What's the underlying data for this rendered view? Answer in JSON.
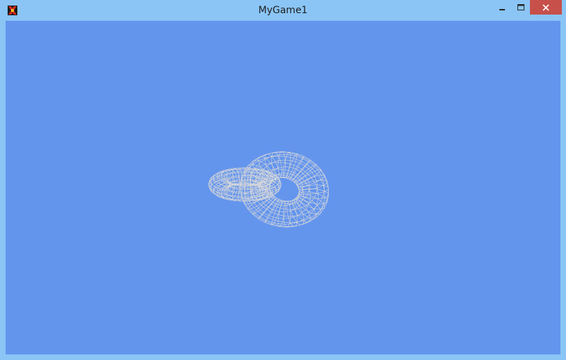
{
  "window": {
    "title": "MyGame1",
    "app_icon": "game-app-icon",
    "controls": {
      "minimize_icon": "minimize-icon",
      "maximize_icon": "maximize-icon",
      "close_icon": "close-icon"
    }
  },
  "scene": {
    "background_color": "#6495ed",
    "wireframe_color": "#d8d8d8",
    "objects": [
      "torus-small",
      "torus-large"
    ]
  }
}
